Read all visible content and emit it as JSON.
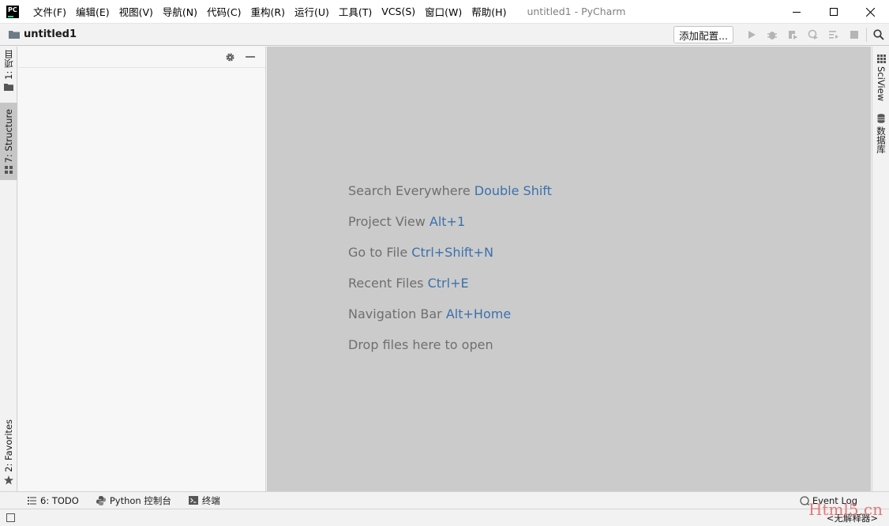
{
  "titlebar": {
    "logo_text": "PC",
    "menu": [
      "文件(F)",
      "编辑(E)",
      "视图(V)",
      "导航(N)",
      "代码(C)",
      "重构(R)",
      "运行(U)",
      "工具(T)",
      "VCS(S)",
      "窗口(W)",
      "帮助(H)"
    ],
    "window_title": "untitled1 - PyCharm"
  },
  "navbar": {
    "crumb": "untitled1",
    "add_config_label": "添加配置..."
  },
  "left_stripe": {
    "project_tab": "1: 项目",
    "structure_tab": "7: Structure",
    "favorites_tab": "2: Favorites"
  },
  "right_stripe": {
    "sciview_tab": "SciView",
    "database_tab": "数据库"
  },
  "editor": {
    "hints": [
      {
        "text": "Search Everywhere",
        "shortcut": "Double Shift"
      },
      {
        "text": "Project View",
        "shortcut": "Alt+1"
      },
      {
        "text": "Go to File",
        "shortcut": "Ctrl+Shift+N"
      },
      {
        "text": "Recent Files",
        "shortcut": "Ctrl+E"
      },
      {
        "text": "Navigation Bar",
        "shortcut": "Alt+Home"
      },
      {
        "text": "Drop files here to open",
        "shortcut": ""
      }
    ]
  },
  "bottom_stripe": {
    "todo_tab": "6: TODO",
    "python_console_tab": "Python 控制台",
    "terminal_tab": "终端",
    "event_log": "Event Log"
  },
  "statusbar": {
    "interpreter": "<无解释器>",
    "watermark": "Html5.cn"
  },
  "colors": {
    "editor_bg": "#cbcbcb",
    "shortcut": "#3b71ad",
    "hint_text": "#6f6f6f",
    "run_disabled": "#b5b5b5"
  }
}
